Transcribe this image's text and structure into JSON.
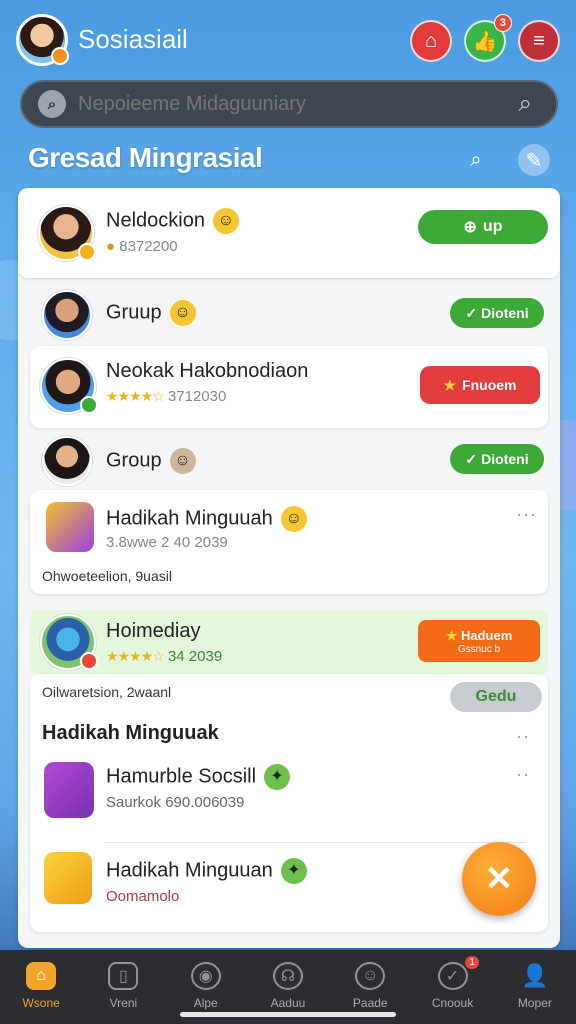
{
  "app": {
    "title": "Sosiasiail"
  },
  "header": {
    "notif_badge": "3"
  },
  "search": {
    "placeholder": "Nepoieeme Midaguuniary"
  },
  "section": {
    "title": "Gresad Mingrasial"
  },
  "items": [
    {
      "name": "Neldockion",
      "sub": "8372200",
      "action": "up"
    },
    {
      "name": "Gruup",
      "action": "Dioteni"
    },
    {
      "name": "Neokak Hakobnodiaon",
      "sub": "3712030",
      "action": "Fnuoem"
    },
    {
      "name": "Group",
      "action": "Dioteni"
    },
    {
      "name": "Hadikah Minguuah",
      "sub": "3.8wwe 2 40 2039",
      "note": "Ohwoeteelion, 9uasil"
    },
    {
      "name": "Hoimediay",
      "sub": "34 2039",
      "action": "Haduem",
      "action_sub": "Gssnuc b",
      "note": "Oilwaretsion, 2waanl"
    },
    {
      "name": "Gedu"
    },
    {
      "name": "Hadikah Minguuak"
    },
    {
      "name": "Hamurble Socsill",
      "sub": "Saurkok 690.006039"
    },
    {
      "name": "Hadikah Minguuan",
      "sub": "Oomamolo"
    }
  ],
  "nav": [
    {
      "label": "Wsone"
    },
    {
      "label": "Vreni"
    },
    {
      "label": "Alpe"
    },
    {
      "label": "Aaduu"
    },
    {
      "label": "Paade"
    },
    {
      "label": "Cnoouk",
      "badge": "1"
    },
    {
      "label": "Moper"
    }
  ],
  "colors": {
    "accent": "#3daa37",
    "danger": "#e23c3c",
    "warning": "#f36a17",
    "fab": "#f17a14"
  }
}
